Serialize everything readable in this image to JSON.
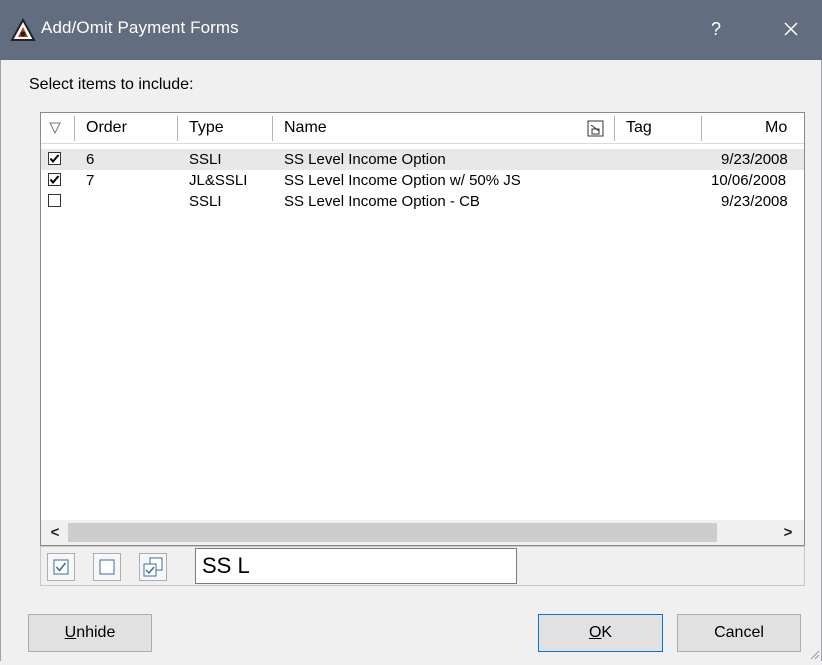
{
  "window": {
    "title": "Add/Omit Payment Forms",
    "help_glyph": "?",
    "titlebar_color": "#626d80"
  },
  "prompt": "Select items to include:",
  "columns": {
    "order": "Order",
    "type": "Type",
    "name": "Name",
    "tag": "Tag",
    "modified": "Mo"
  },
  "rows": [
    {
      "checked": true,
      "order": "6",
      "type": "SSLI",
      "name": "SS Level Income Option",
      "date": "9/23/2008"
    },
    {
      "checked": true,
      "order": "7",
      "type": "JL&SSLI",
      "name": "SS Level Income Option w/ 50% JS",
      "date": "10/06/2008"
    },
    {
      "checked": false,
      "order": "",
      "type": "SSLI",
      "name": "SS Level Income Option - CB",
      "date": "9/23/2008"
    }
  ],
  "scrollbar": {
    "left_glyph": "<",
    "right_glyph": ">"
  },
  "filter": {
    "value": "SS L"
  },
  "buttons": {
    "unhide_mnemonic": "U",
    "unhide_rest": "nhide",
    "ok_mnemonic": "O",
    "ok_rest": "K",
    "cancel": "Cancel"
  },
  "icons": {
    "app": "app-logo-icon",
    "close": "close-icon",
    "sort": "sort-indicator-icon",
    "column_chooser": "column-chooser-icon",
    "check_all": "check-all-icon",
    "uncheck_all": "uncheck-all-icon",
    "invert": "invert-selection-icon",
    "grip": "resize-grip-icon"
  }
}
